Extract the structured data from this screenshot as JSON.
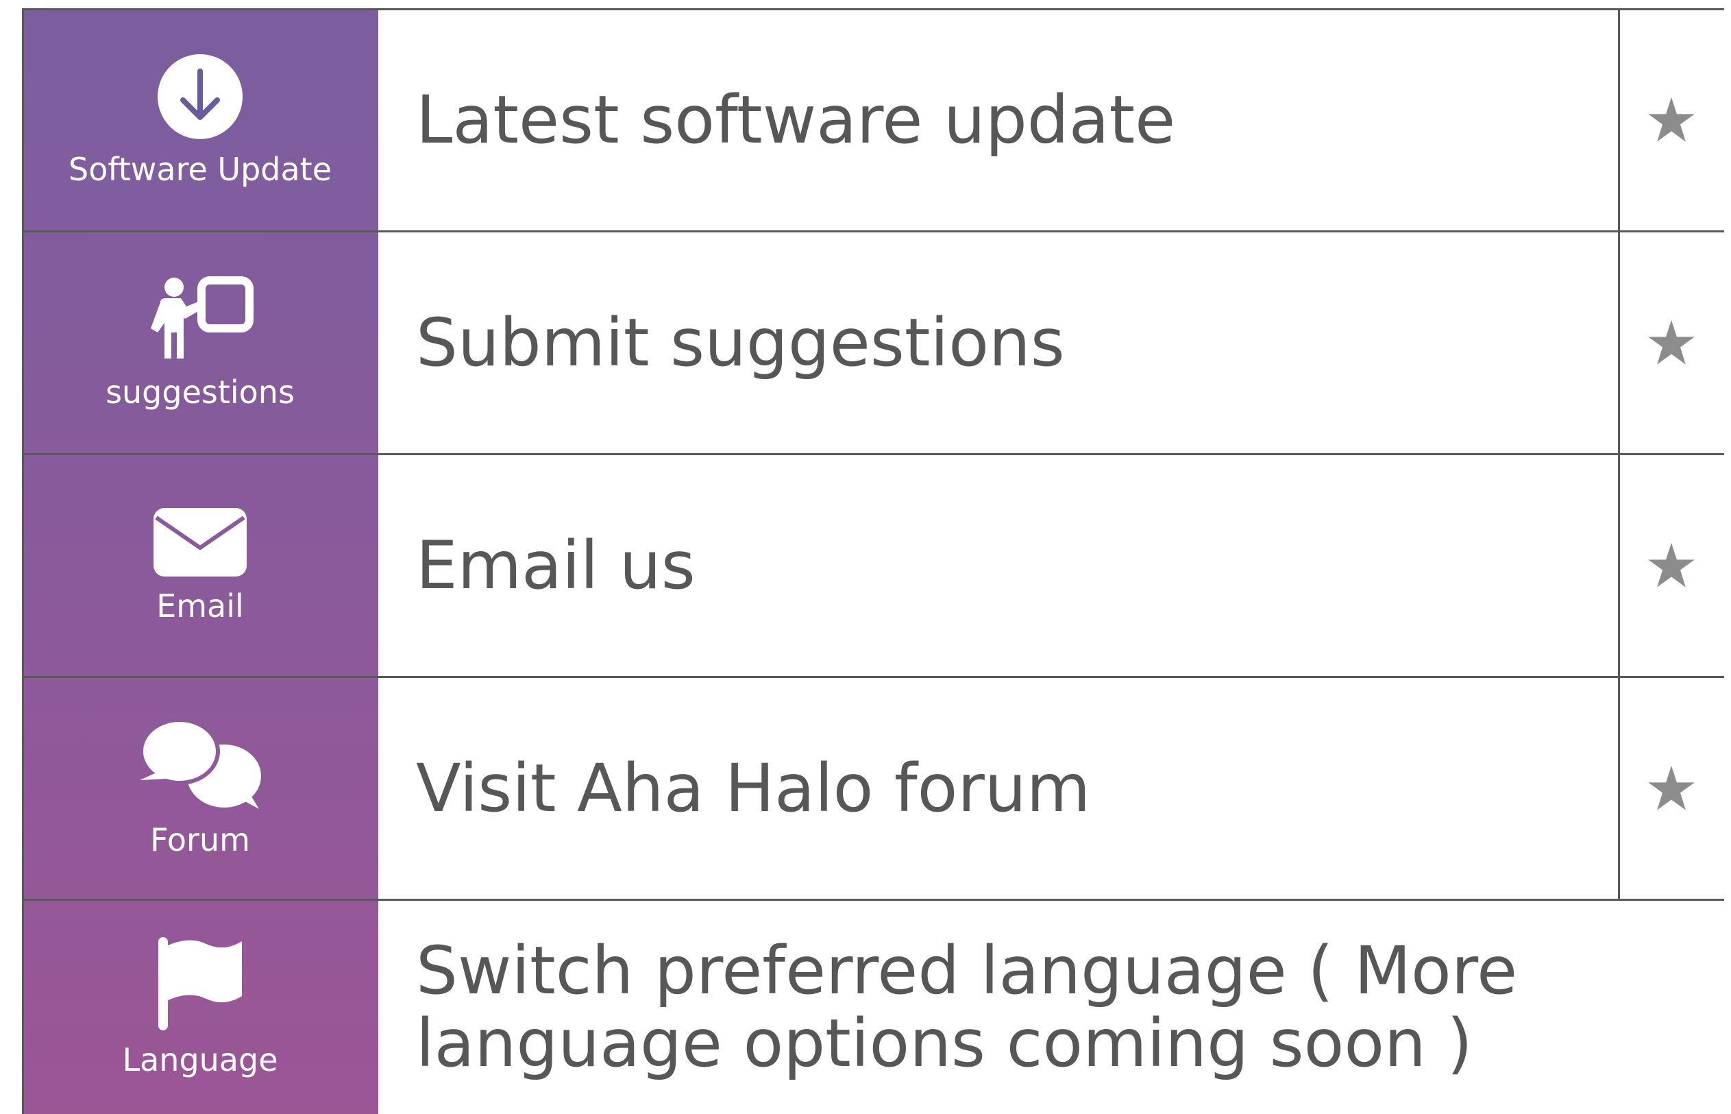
{
  "menu": {
    "items": [
      {
        "icon": "download-icon",
        "icon_label": "Software Update",
        "text": "Latest software update",
        "favorite": true
      },
      {
        "icon": "presentation-icon",
        "icon_label": "suggestions",
        "text": "Submit suggestions",
        "favorite": true
      },
      {
        "icon": "envelope-icon",
        "icon_label": "Email",
        "text": "Email us",
        "favorite": true
      },
      {
        "icon": "chat-bubbles-icon",
        "icon_label": "Forum",
        "text": "Visit Aha Halo forum",
        "favorite": true
      },
      {
        "icon": "flag-icon",
        "icon_label": "Language",
        "text": "Switch preferred language ( More language options coming soon )",
        "favorite": false
      }
    ]
  },
  "colors": {
    "sidebar_top": "#7b5e9f",
    "sidebar_bottom": "#9b5696",
    "text": "#575757",
    "border": "#595959",
    "star": "#8c8c8c",
    "icon_white": "#ffffff"
  }
}
